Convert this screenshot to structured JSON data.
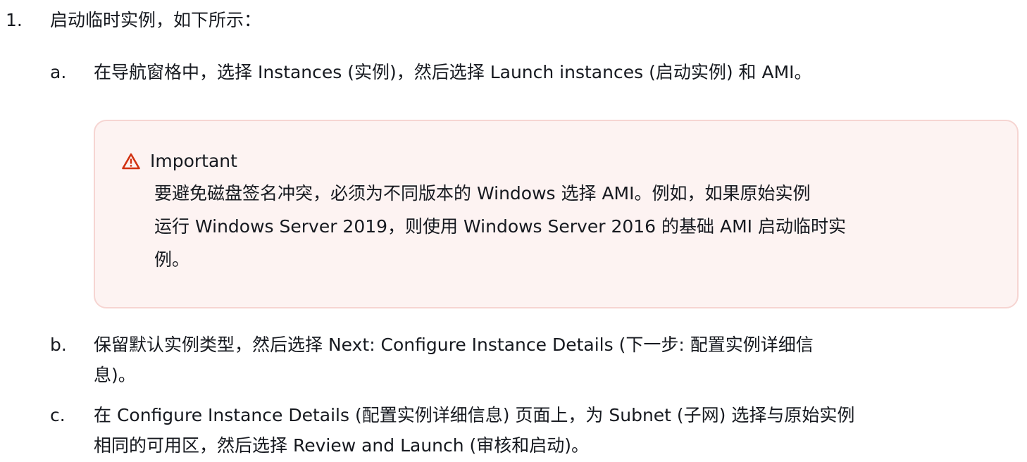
{
  "step1": {
    "number": "1.",
    "text": "启动临时实例，如下所示："
  },
  "substeps": {
    "a": {
      "marker": "a.",
      "text": "在导航窗格中，选择 Instances (实例)，然后选择 Launch instances (启动实例) 和 AMI。"
    },
    "b": {
      "marker": "b.",
      "lines": [
        "保留默认实例类型，然后选择 Next: Configure Instance Details (下一步: 配置实例详细信",
        "息)。"
      ]
    },
    "c": {
      "marker": "c.",
      "lines": [
        "在 Configure Instance Details (配置实例详细信息) 页面上，为 Subnet (子网) 选择与原始实例",
        "相同的可用区，然后选择 Review and Launch (审核和启动)。"
      ]
    }
  },
  "callout": {
    "icon": "warning-triangle-icon",
    "title": "Important",
    "color": "#d13212",
    "lines": [
      "要避免磁盘签名冲突，必须为不同版本的 Windows 选择 AMI。例如，如果原始实例",
      "运行 Windows Server 2019，则使用 Windows Server 2016 的基础 AMI 启动临时实",
      "例。"
    ]
  }
}
